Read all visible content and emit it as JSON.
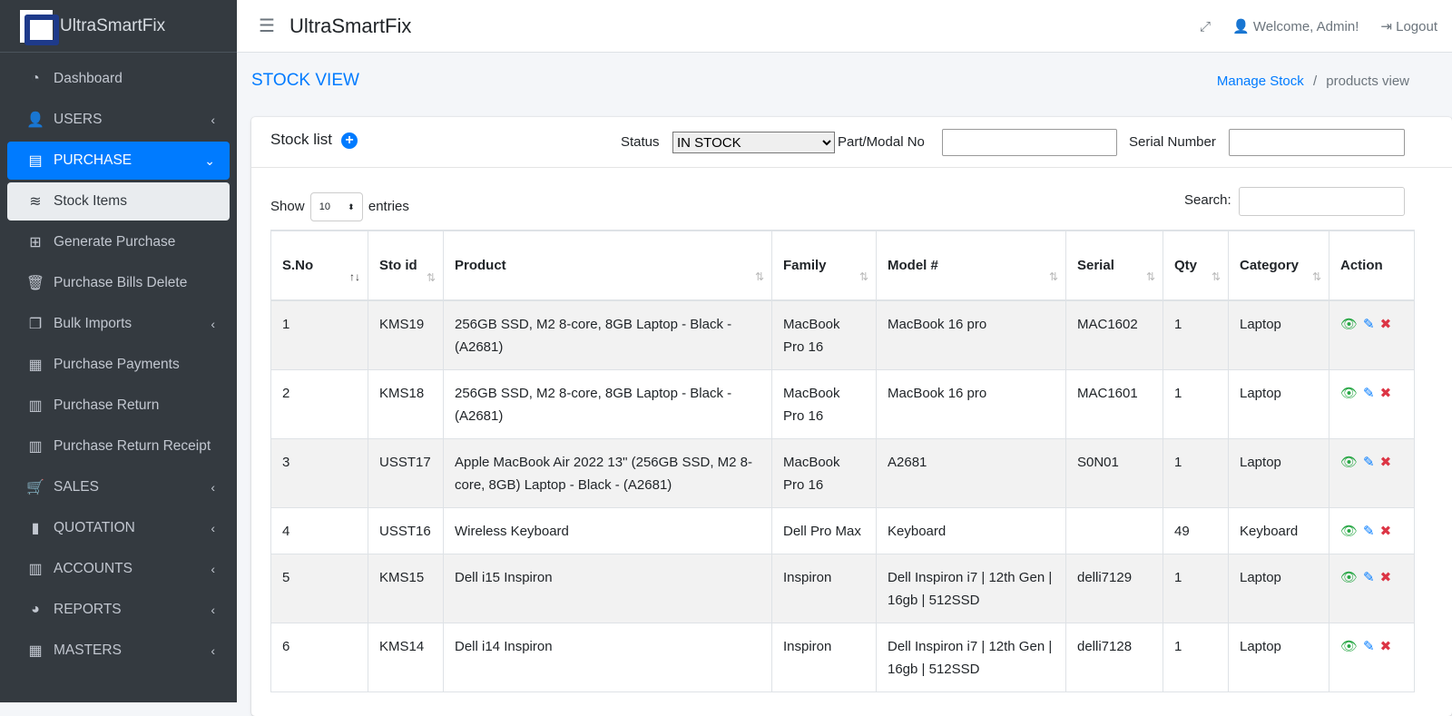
{
  "brand": "UltraSmartFix",
  "sidebar": [
    {
      "label": "Dashboard",
      "icon": "gauge-icon",
      "glyph": "◔",
      "chev": ""
    },
    {
      "label": "USERS",
      "icon": "user-icon",
      "glyph": "👤",
      "chev": "‹"
    },
    {
      "label": "PURCHASE",
      "icon": "store-icon",
      "glyph": "▤",
      "chev": "⌄",
      "state": "active"
    },
    {
      "label": "Stock Items",
      "icon": "database-icon",
      "glyph": "≋",
      "chev": "",
      "state": "sub-active"
    },
    {
      "label": "Generate Purchase",
      "icon": "plus-square-icon",
      "glyph": "⊞",
      "chev": ""
    },
    {
      "label": "Purchase Bills Delete",
      "icon": "trash-icon",
      "glyph": "🗑",
      "chev": ""
    },
    {
      "label": "Bulk Imports",
      "icon": "copy-icon",
      "glyph": "❐",
      "chev": "‹"
    },
    {
      "label": "Purchase Payments",
      "icon": "file-icon",
      "glyph": "▦",
      "chev": ""
    },
    {
      "label": "Purchase Return",
      "icon": "cash-register-icon",
      "glyph": "▥",
      "chev": ""
    },
    {
      "label": "Purchase Return Receipt",
      "icon": "cash-register-icon",
      "glyph": "▥",
      "chev": ""
    },
    {
      "label": "SALES",
      "icon": "cart-icon",
      "glyph": "🛒",
      "chev": "‹"
    },
    {
      "label": "QUOTATION",
      "icon": "book-icon",
      "glyph": "▮",
      "chev": "‹"
    },
    {
      "label": "ACCOUNTS",
      "icon": "cash-register-icon",
      "glyph": "▥",
      "chev": "‹"
    },
    {
      "label": "REPORTS",
      "icon": "pie-chart-icon",
      "glyph": "◕",
      "chev": "‹"
    },
    {
      "label": "MASTERS",
      "icon": "grid-icon",
      "glyph": "▦",
      "chev": "‹"
    }
  ],
  "header": {
    "title": "UltraSmartFix",
    "welcome": "Welcome, Admin!",
    "logout": "Logout"
  },
  "page": {
    "title": "STOCK VIEW",
    "breadcrumb_link": "Manage Stock",
    "breadcrumb_sep": "/",
    "breadcrumb_current": "products view"
  },
  "card": {
    "title": "Stock list",
    "status_label": "Status",
    "status_value": "IN STOCK",
    "part_label": "Part/Modal No",
    "serial_label": "Serial Number",
    "show": "Show",
    "entries": "entries",
    "length": "10",
    "search": "Search:"
  },
  "table": {
    "headers": [
      "S.No",
      "Sto id",
      "Product",
      "Family",
      "Model #",
      "Serial",
      "Qty",
      "Category",
      "Action"
    ],
    "rows": [
      [
        "1",
        "KMS19",
        "256GB SSD, M2 8-core, 8GB Laptop - Black - (A2681)",
        "MacBook Pro 16",
        "MacBook 16 pro",
        "MAC1602",
        "1",
        "Laptop"
      ],
      [
        "2",
        "KMS18",
        "256GB SSD, M2 8-core, 8GB Laptop - Black - (A2681)",
        "MacBook Pro 16",
        "MacBook 16 pro",
        "MAC1601",
        "1",
        "Laptop"
      ],
      [
        "3",
        "USST17",
        "Apple MacBook Air 2022 13\" (256GB SSD, M2 8-core, 8GB) Laptop - Black - (A2681)",
        "MacBook Pro 16",
        "A2681",
        "S0N01",
        "1",
        "Laptop"
      ],
      [
        "4",
        "USST16",
        "Wireless Keyboard",
        "Dell Pro Max",
        "Keyboard",
        "",
        "49",
        "Keyboard"
      ],
      [
        "5",
        "KMS15",
        "Dell i15 Inspiron",
        "Inspiron",
        "Dell Inspiron i7 | 12th Gen | 16gb | 512SSD",
        "delli7129",
        "1",
        "Laptop"
      ],
      [
        "6",
        "KMS14",
        "Dell i14 Inspiron",
        "Inspiron",
        "Dell Inspiron i7 | 12th Gen | 16gb | 512SSD",
        "delli7128",
        "1",
        "Laptop"
      ]
    ]
  }
}
